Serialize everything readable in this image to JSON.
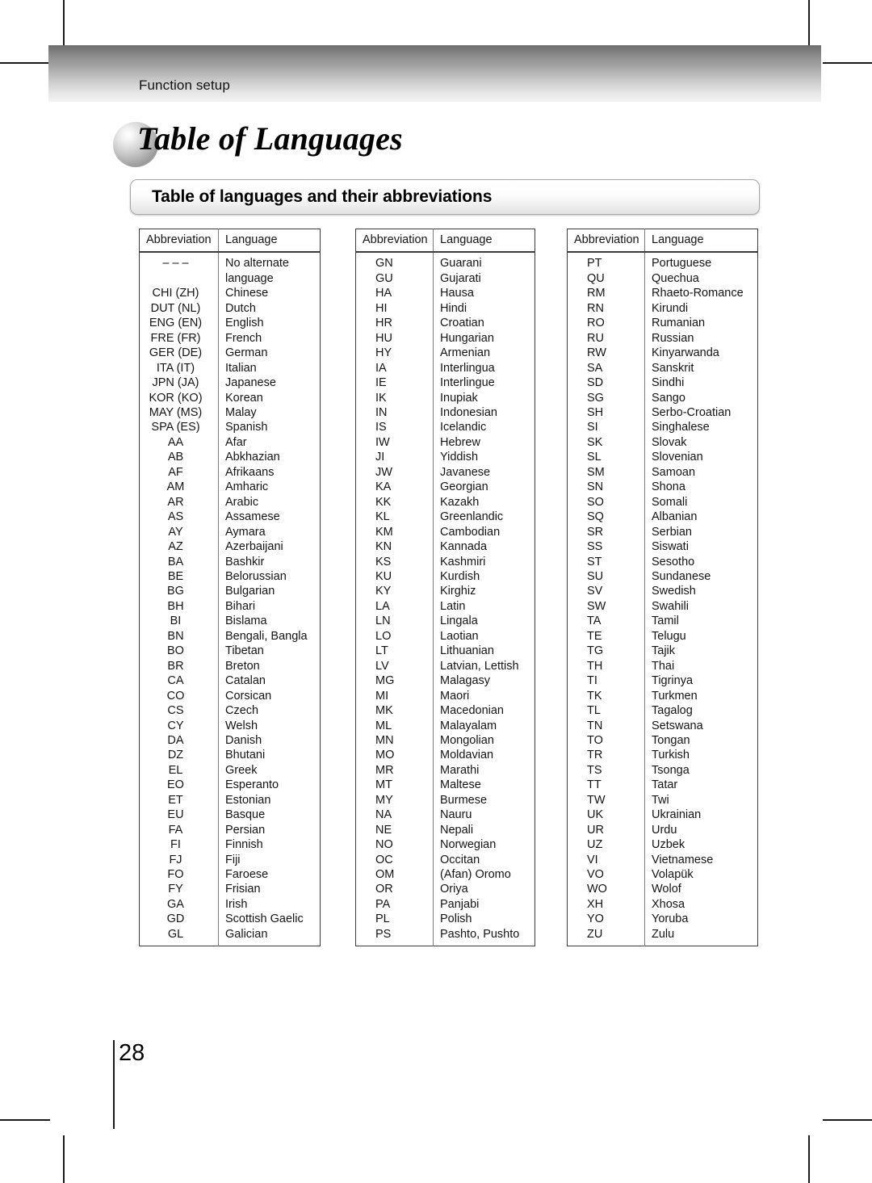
{
  "header": {
    "section_label": "Function setup"
  },
  "chapter": {
    "title": "Table of Languages",
    "bullet_icon": "sphere-bullet-icon"
  },
  "subtitle": {
    "text": "Table of languages and their abbreviations"
  },
  "table_columns": {
    "abbreviation": "Abbreviation",
    "language": "Language"
  },
  "tables": [
    {
      "id": "table-1",
      "rows": [
        {
          "abbr": "– – –",
          "language": "No alternate\nlanguage"
        },
        {
          "abbr": "CHI (ZH)",
          "language": "Chinese"
        },
        {
          "abbr": "DUT (NL)",
          "language": "Dutch"
        },
        {
          "abbr": "ENG (EN)",
          "language": "English"
        },
        {
          "abbr": "FRE (FR)",
          "language": "French"
        },
        {
          "abbr": "GER (DE)",
          "language": "German"
        },
        {
          "abbr": "ITA (IT)",
          "language": "Italian"
        },
        {
          "abbr": "JPN (JA)",
          "language": "Japanese"
        },
        {
          "abbr": "KOR (KO)",
          "language": "Korean"
        },
        {
          "abbr": "MAY (MS)",
          "language": "Malay"
        },
        {
          "abbr": "SPA (ES)",
          "language": "Spanish"
        },
        {
          "abbr": "AA",
          "language": "Afar"
        },
        {
          "abbr": "AB",
          "language": "Abkhazian"
        },
        {
          "abbr": "AF",
          "language": "Afrikaans"
        },
        {
          "abbr": "AM",
          "language": "Amharic"
        },
        {
          "abbr": "AR",
          "language": "Arabic"
        },
        {
          "abbr": "AS",
          "language": "Assamese"
        },
        {
          "abbr": "AY",
          "language": "Aymara"
        },
        {
          "abbr": "AZ",
          "language": "Azerbaijani"
        },
        {
          "abbr": "BA",
          "language": "Bashkir"
        },
        {
          "abbr": "BE",
          "language": "Belorussian"
        },
        {
          "abbr": "BG",
          "language": "Bulgarian"
        },
        {
          "abbr": "BH",
          "language": "Bihari"
        },
        {
          "abbr": "BI",
          "language": "Bislama"
        },
        {
          "abbr": "BN",
          "language": "Bengali, Bangla"
        },
        {
          "abbr": "BO",
          "language": "Tibetan"
        },
        {
          "abbr": "BR",
          "language": "Breton"
        },
        {
          "abbr": "CA",
          "language": "Catalan"
        },
        {
          "abbr": "CO",
          "language": "Corsican"
        },
        {
          "abbr": "CS",
          "language": "Czech"
        },
        {
          "abbr": "CY",
          "language": "Welsh"
        },
        {
          "abbr": "DA",
          "language": "Danish"
        },
        {
          "abbr": "DZ",
          "language": "Bhutani"
        },
        {
          "abbr": "EL",
          "language": "Greek"
        },
        {
          "abbr": "EO",
          "language": "Esperanto"
        },
        {
          "abbr": "ET",
          "language": "Estonian"
        },
        {
          "abbr": "EU",
          "language": "Basque"
        },
        {
          "abbr": "FA",
          "language": "Persian"
        },
        {
          "abbr": "FI",
          "language": "Finnish"
        },
        {
          "abbr": "FJ",
          "language": "Fiji"
        },
        {
          "abbr": "FO",
          "language": "Faroese"
        },
        {
          "abbr": "FY",
          "language": "Frisian"
        },
        {
          "abbr": "GA",
          "language": "Irish"
        },
        {
          "abbr": "GD",
          "language": "Scottish Gaelic"
        },
        {
          "abbr": "GL",
          "language": "Galician"
        }
      ]
    },
    {
      "id": "table-2",
      "rows": [
        {
          "abbr": "GN",
          "language": "Guarani"
        },
        {
          "abbr": "GU",
          "language": "Gujarati"
        },
        {
          "abbr": "HA",
          "language": "Hausa"
        },
        {
          "abbr": "HI",
          "language": "Hindi"
        },
        {
          "abbr": "HR",
          "language": "Croatian"
        },
        {
          "abbr": "HU",
          "language": "Hungarian"
        },
        {
          "abbr": "HY",
          "language": "Armenian"
        },
        {
          "abbr": "IA",
          "language": "Interlingua"
        },
        {
          "abbr": "IE",
          "language": "Interlingue"
        },
        {
          "abbr": "IK",
          "language": "Inupiak"
        },
        {
          "abbr": "IN",
          "language": "Indonesian"
        },
        {
          "abbr": "IS",
          "language": "Icelandic"
        },
        {
          "abbr": "IW",
          "language": "Hebrew"
        },
        {
          "abbr": "JI",
          "language": "Yiddish"
        },
        {
          "abbr": "JW",
          "language": "Javanese"
        },
        {
          "abbr": "KA",
          "language": "Georgian"
        },
        {
          "abbr": "KK",
          "language": "Kazakh"
        },
        {
          "abbr": "KL",
          "language": "Greenlandic"
        },
        {
          "abbr": "KM",
          "language": "Cambodian"
        },
        {
          "abbr": "KN",
          "language": "Kannada"
        },
        {
          "abbr": "KS",
          "language": "Kashmiri"
        },
        {
          "abbr": "KU",
          "language": "Kurdish"
        },
        {
          "abbr": "KY",
          "language": "Kirghiz"
        },
        {
          "abbr": "LA",
          "language": "Latin"
        },
        {
          "abbr": "LN",
          "language": "Lingala"
        },
        {
          "abbr": "LO",
          "language": "Laotian"
        },
        {
          "abbr": "LT",
          "language": "Lithuanian"
        },
        {
          "abbr": "LV",
          "language": "Latvian, Lettish"
        },
        {
          "abbr": "MG",
          "language": "Malagasy"
        },
        {
          "abbr": "MI",
          "language": "Maori"
        },
        {
          "abbr": "MK",
          "language": "Macedonian"
        },
        {
          "abbr": "ML",
          "language": "Malayalam"
        },
        {
          "abbr": "MN",
          "language": "Mongolian"
        },
        {
          "abbr": "MO",
          "language": "Moldavian"
        },
        {
          "abbr": "MR",
          "language": "Marathi"
        },
        {
          "abbr": "MT",
          "language": "Maltese"
        },
        {
          "abbr": "MY",
          "language": "Burmese"
        },
        {
          "abbr": "NA",
          "language": "Nauru"
        },
        {
          "abbr": "NE",
          "language": "Nepali"
        },
        {
          "abbr": "NO",
          "language": "Norwegian"
        },
        {
          "abbr": "OC",
          "language": "Occitan"
        },
        {
          "abbr": "OM",
          "language": "(Afan) Oromo"
        },
        {
          "abbr": "OR",
          "language": "Oriya"
        },
        {
          "abbr": "PA",
          "language": "Panjabi"
        },
        {
          "abbr": "PL",
          "language": "Polish"
        },
        {
          "abbr": "PS",
          "language": "Pashto, Pushto"
        }
      ]
    },
    {
      "id": "table-3",
      "rows": [
        {
          "abbr": "PT",
          "language": "Portuguese"
        },
        {
          "abbr": "QU",
          "language": "Quechua"
        },
        {
          "abbr": "RM",
          "language": "Rhaeto-Romance"
        },
        {
          "abbr": "RN",
          "language": "Kirundi"
        },
        {
          "abbr": "RO",
          "language": "Rumanian"
        },
        {
          "abbr": "RU",
          "language": "Russian"
        },
        {
          "abbr": "RW",
          "language": "Kinyarwanda"
        },
        {
          "abbr": "SA",
          "language": "Sanskrit"
        },
        {
          "abbr": "SD",
          "language": "Sindhi"
        },
        {
          "abbr": "SG",
          "language": "Sango"
        },
        {
          "abbr": "SH",
          "language": "Serbo-Croatian"
        },
        {
          "abbr": "SI",
          "language": "Singhalese"
        },
        {
          "abbr": "SK",
          "language": "Slovak"
        },
        {
          "abbr": "SL",
          "language": "Slovenian"
        },
        {
          "abbr": "SM",
          "language": "Samoan"
        },
        {
          "abbr": "SN",
          "language": "Shona"
        },
        {
          "abbr": "SO",
          "language": "Somali"
        },
        {
          "abbr": "SQ",
          "language": "Albanian"
        },
        {
          "abbr": "SR",
          "language": "Serbian"
        },
        {
          "abbr": "SS",
          "language": "Siswati"
        },
        {
          "abbr": "ST",
          "language": "Sesotho"
        },
        {
          "abbr": "SU",
          "language": "Sundanese"
        },
        {
          "abbr": "SV",
          "language": "Swedish"
        },
        {
          "abbr": "SW",
          "language": "Swahili"
        },
        {
          "abbr": "TA",
          "language": "Tamil"
        },
        {
          "abbr": "TE",
          "language": "Telugu"
        },
        {
          "abbr": "TG",
          "language": "Tajik"
        },
        {
          "abbr": "TH",
          "language": "Thai"
        },
        {
          "abbr": "TI",
          "language": "Tigrinya"
        },
        {
          "abbr": "TK",
          "language": "Turkmen"
        },
        {
          "abbr": "TL",
          "language": "Tagalog"
        },
        {
          "abbr": "TN",
          "language": "Setswana"
        },
        {
          "abbr": "TO",
          "language": "Tongan"
        },
        {
          "abbr": "TR",
          "language": "Turkish"
        },
        {
          "abbr": "TS",
          "language": "Tsonga"
        },
        {
          "abbr": "TT",
          "language": "Tatar"
        },
        {
          "abbr": "TW",
          "language": "Twi"
        },
        {
          "abbr": "UK",
          "language": "Ukrainian"
        },
        {
          "abbr": "UR",
          "language": "Urdu"
        },
        {
          "abbr": "UZ",
          "language": "Uzbek"
        },
        {
          "abbr": "VI",
          "language": "Vietnamese"
        },
        {
          "abbr": "VO",
          "language": "Volapük"
        },
        {
          "abbr": "WO",
          "language": "Wolof"
        },
        {
          "abbr": "XH",
          "language": "Xhosa"
        },
        {
          "abbr": "YO",
          "language": "Yoruba"
        },
        {
          "abbr": "ZU",
          "language": "Zulu"
        }
      ]
    }
  ],
  "footer": {
    "page_number": "28"
  }
}
